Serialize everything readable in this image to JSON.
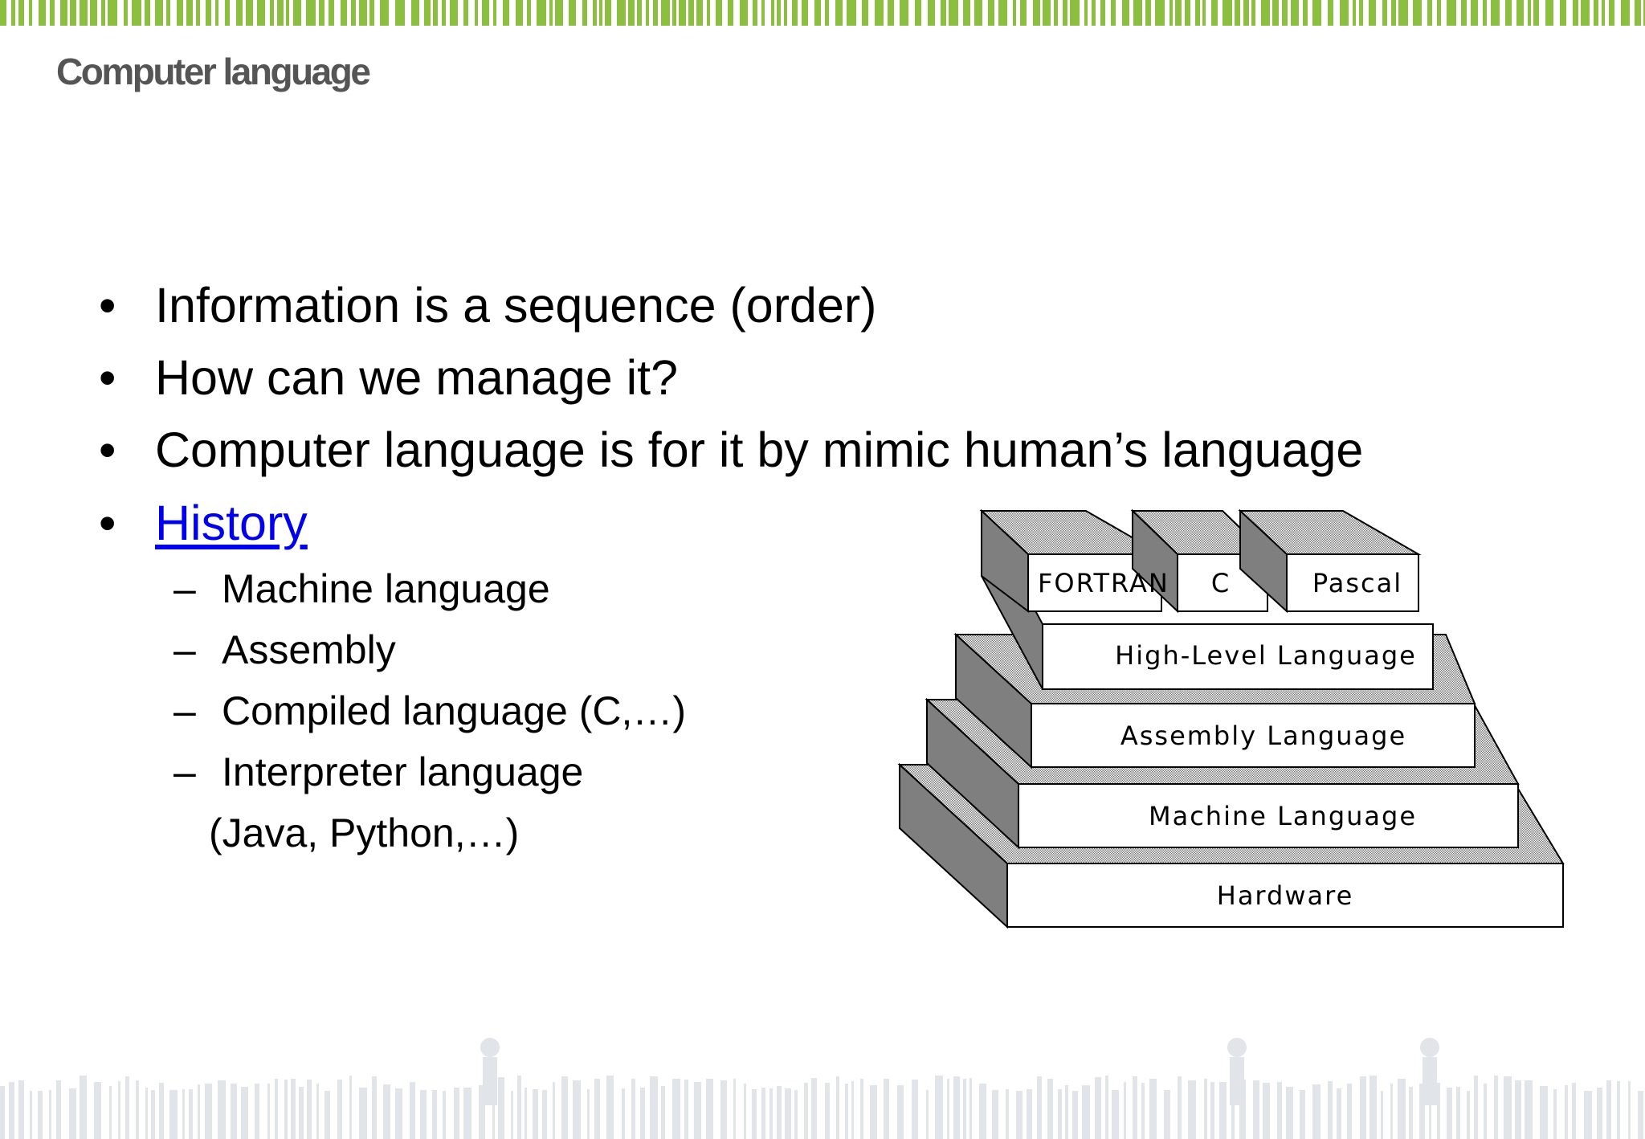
{
  "slide": {
    "title": "Computer language",
    "bullets": [
      "Information is a sequence (order)",
      "How can we manage it?",
      "Computer language is for it by mimic human’s language"
    ],
    "history_link": "History",
    "sub_items": [
      "Machine language",
      "Assembly",
      "Compiled language (C,…)",
      "Interpreter language"
    ],
    "sub_continuation": "(Java, Python,…)"
  },
  "diagram": {
    "layers": {
      "hardware": "Hardware",
      "machine": "Machine Language",
      "assembly": "Assembly Language",
      "high_level": "High-Level Language"
    },
    "languages": [
      "FORTRAN",
      "C",
      "Pascal"
    ]
  },
  "colors": {
    "accent_green": "#8cbf3f",
    "band_gray": "#e1e4e8",
    "link_blue": "#0000ee",
    "title_gray": "#555555"
  }
}
